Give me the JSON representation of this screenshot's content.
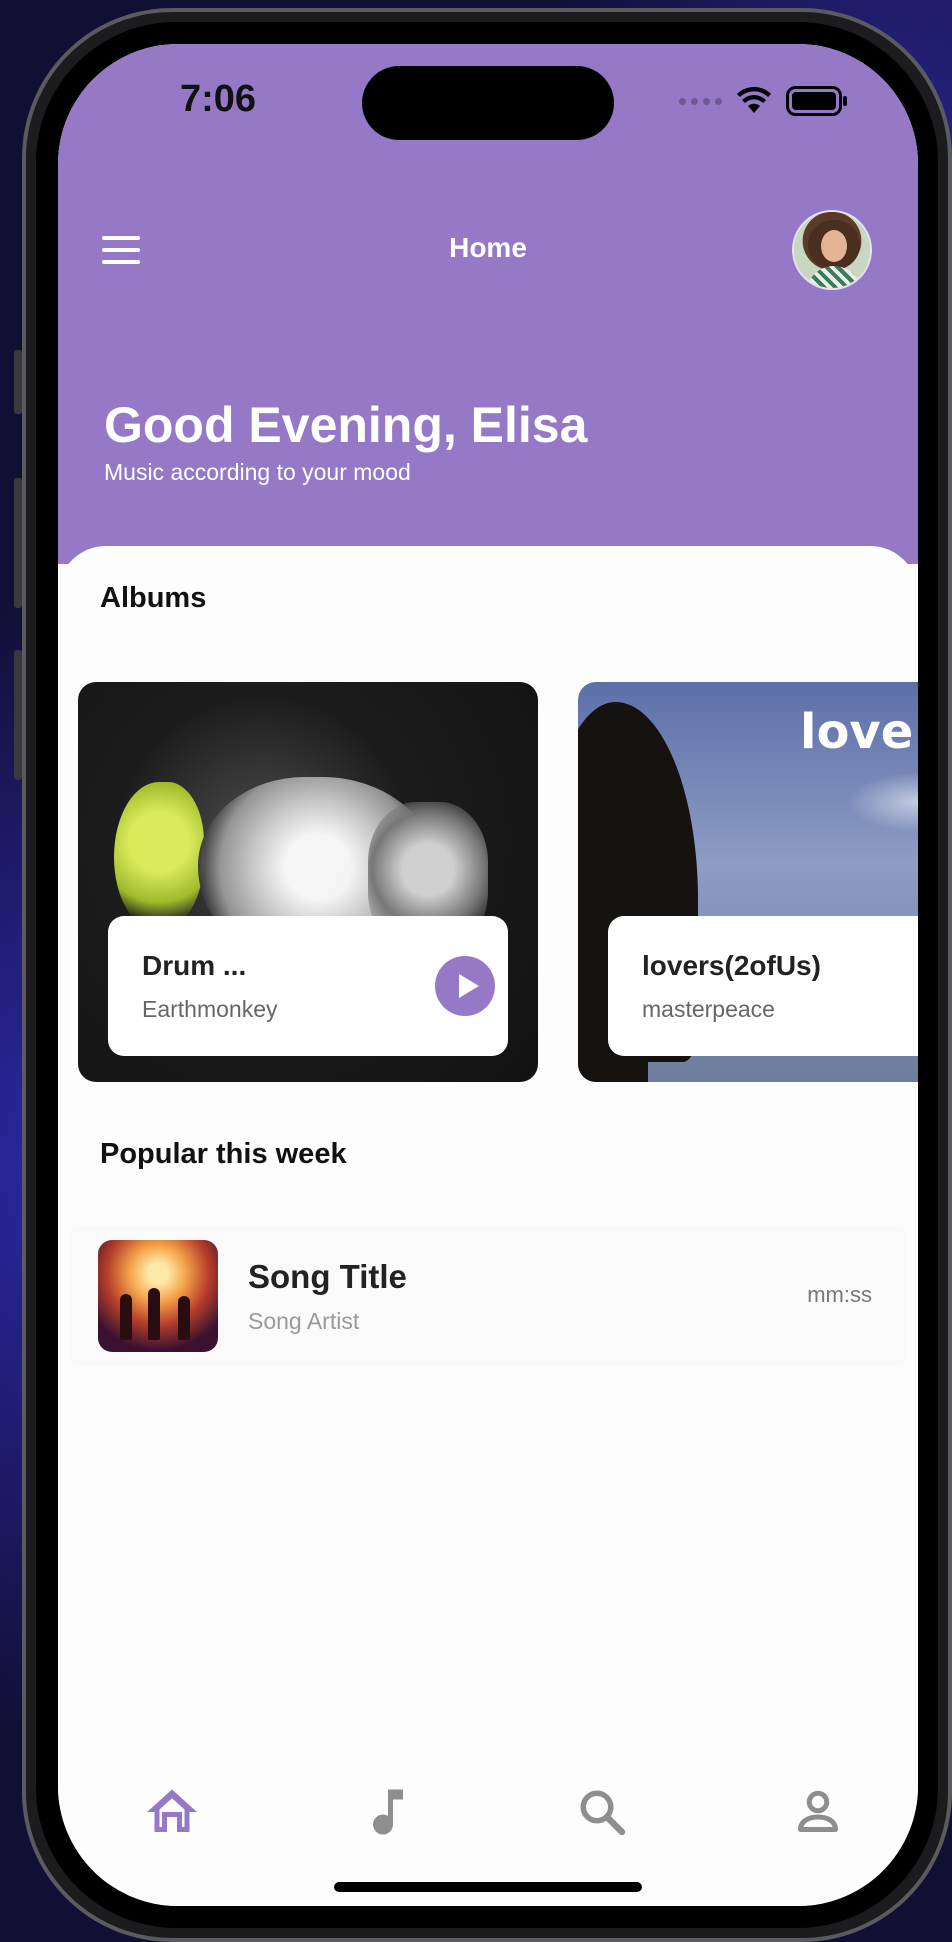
{
  "status_bar": {
    "time": "7:06"
  },
  "header": {
    "title": "Home",
    "greeting": "Good Evening, Elisa",
    "subtitle": "Music according to your mood"
  },
  "albums_section": {
    "title": "Albums",
    "items": [
      {
        "name": "Drum ...",
        "artist": "Earthmonkey"
      },
      {
        "name": "lovers(2ofUs)",
        "artist": "masterpeace",
        "cover_text": "love"
      }
    ]
  },
  "popular_section": {
    "title": "Popular this week",
    "songs": [
      {
        "title": "Song Title",
        "artist": "Song Artist",
        "duration": "mm:ss"
      }
    ]
  },
  "tab_bar": {
    "tabs": [
      {
        "icon": "home-icon",
        "active": true
      },
      {
        "icon": "music-note-icon",
        "active": false
      },
      {
        "icon": "search-icon",
        "active": false
      },
      {
        "icon": "profile-icon",
        "active": false
      }
    ]
  },
  "colors": {
    "accent": "#9579c6",
    "inactive_icon": "#8e8e8e",
    "background": "#fdfdfd"
  }
}
